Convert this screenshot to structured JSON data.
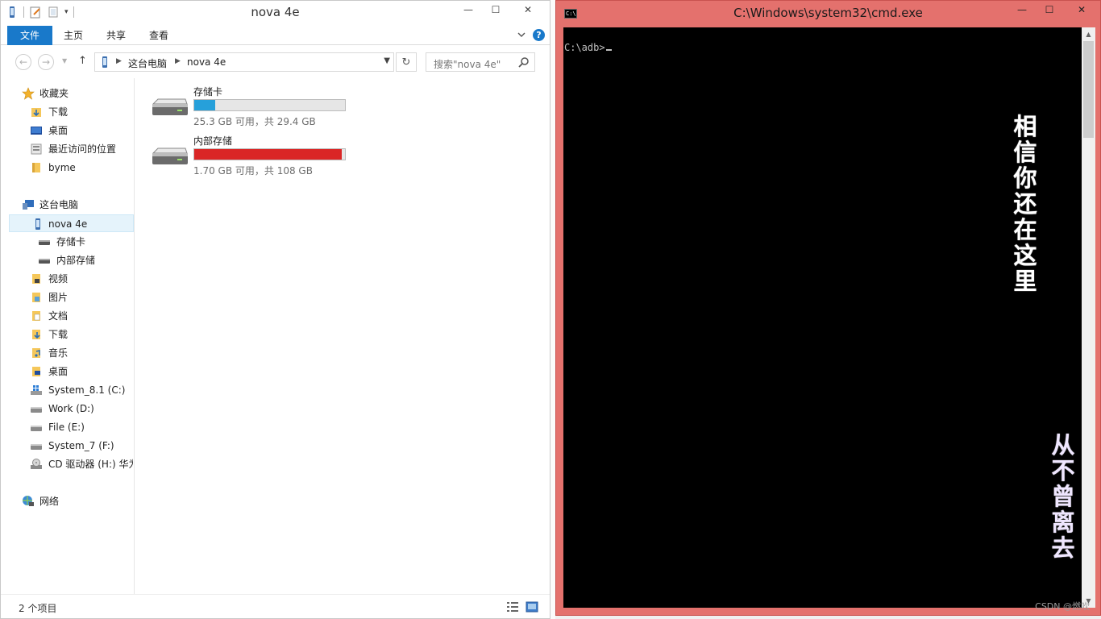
{
  "explorer": {
    "title": "nova 4e",
    "tabs": {
      "file": "文件",
      "home": "主页",
      "share": "共享",
      "view": "查看"
    },
    "breadcrumb": [
      "这台电脑",
      "nova 4e"
    ],
    "search_placeholder": "搜索\"nova 4e\"",
    "nav": {
      "favorites": "收藏夹",
      "fav_items": [
        "下载",
        "桌面",
        "最近访问的位置",
        "byme"
      ],
      "this_pc": "这台电脑",
      "device": "nova 4e",
      "device_items": [
        "存储卡",
        "内部存储"
      ],
      "libs": [
        "视频",
        "图片",
        "文档",
        "下载",
        "音乐",
        "桌面"
      ],
      "drives": [
        "System_8.1 (C:)",
        "Work (D:)",
        "File (E:)",
        "System_7 (F:)",
        "CD 驱动器 (H:) 华为"
      ],
      "network": "网络"
    },
    "storage": [
      {
        "name": "存储卡",
        "info": "25.3 GB 可用，共 29.4 GB",
        "used_fraction": 0.14,
        "color": "#26a0da"
      },
      {
        "name": "内部存储",
        "info": "1.70 GB 可用，共 108 GB",
        "used_fraction": 0.98,
        "color": "#da2626"
      }
    ],
    "status": "2 个项目"
  },
  "cmd": {
    "title": "C:\\Windows\\system32\\cmd.exe",
    "icon_text": "C:\\",
    "prompt": "C:\\adb>",
    "overlay_text_1": "相信你还在这里",
    "overlay_text_2": "从不曾离去"
  },
  "watermark": "CSDN @燃吹"
}
